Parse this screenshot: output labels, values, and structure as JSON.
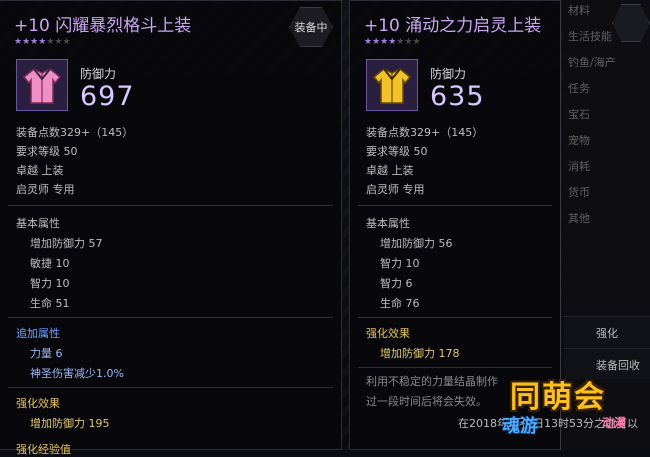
{
  "left_card": {
    "title": "+10 闪耀暴烈格斗上装",
    "equipped_label": "装备中",
    "defense_label": "防御力",
    "defense_value": "697",
    "stars_filled": 4,
    "stars_total": 7,
    "icon": "pink-jacket-icon",
    "equip_points": "装备点数329+（145）",
    "level_req": "要求等级 50",
    "grade_slot": "卓越 上装",
    "class_only": "启灵师 专用",
    "base_header": "基本属性",
    "base_stats": [
      "增加防御力 57",
      "敏捷 10",
      "智力 10",
      "生命 51"
    ],
    "extra_header": "追加属性",
    "extra_stats": [
      "力量 6",
      "神圣伤害减少1.0%"
    ],
    "enhance_header": "强化效果",
    "enhance_stats": [
      "增加防御力 195"
    ],
    "next_header": "强化经验值"
  },
  "right_card": {
    "title": "+10 涌动之力启灵上装",
    "defense_label": "防御力",
    "defense_value": "635",
    "stars_filled": 4,
    "stars_total": 7,
    "icon": "yellow-jacket-icon",
    "equip_points": "装备点数329+（145）",
    "level_req": "要求等级 50",
    "grade_slot": "卓越 上装",
    "class_only": "启灵师 专用",
    "base_header": "基本属性",
    "base_stats": [
      "增加防御力 56",
      "智力 10",
      "智力 6",
      "生命 76"
    ],
    "enhance_header": "强化效果",
    "enhance_stats": [
      "增加防御力 178"
    ],
    "note_line1": "利用不稳定的力量结晶制作",
    "note_line2": "过一段时间后将会失效。",
    "expire_line": "在2018年2月6日13时53分之前可以"
  },
  "right_menu": [
    "材料",
    "生活技能",
    "钓鱼/海产",
    "任务",
    "宝石",
    "宠物",
    "消耗",
    "货币",
    "其他"
  ],
  "right_buttons": [
    "强化",
    "装备回收"
  ],
  "watermark": {
    "main": "同萌会",
    "sub": "魂游",
    "sub2": "动漫"
  }
}
